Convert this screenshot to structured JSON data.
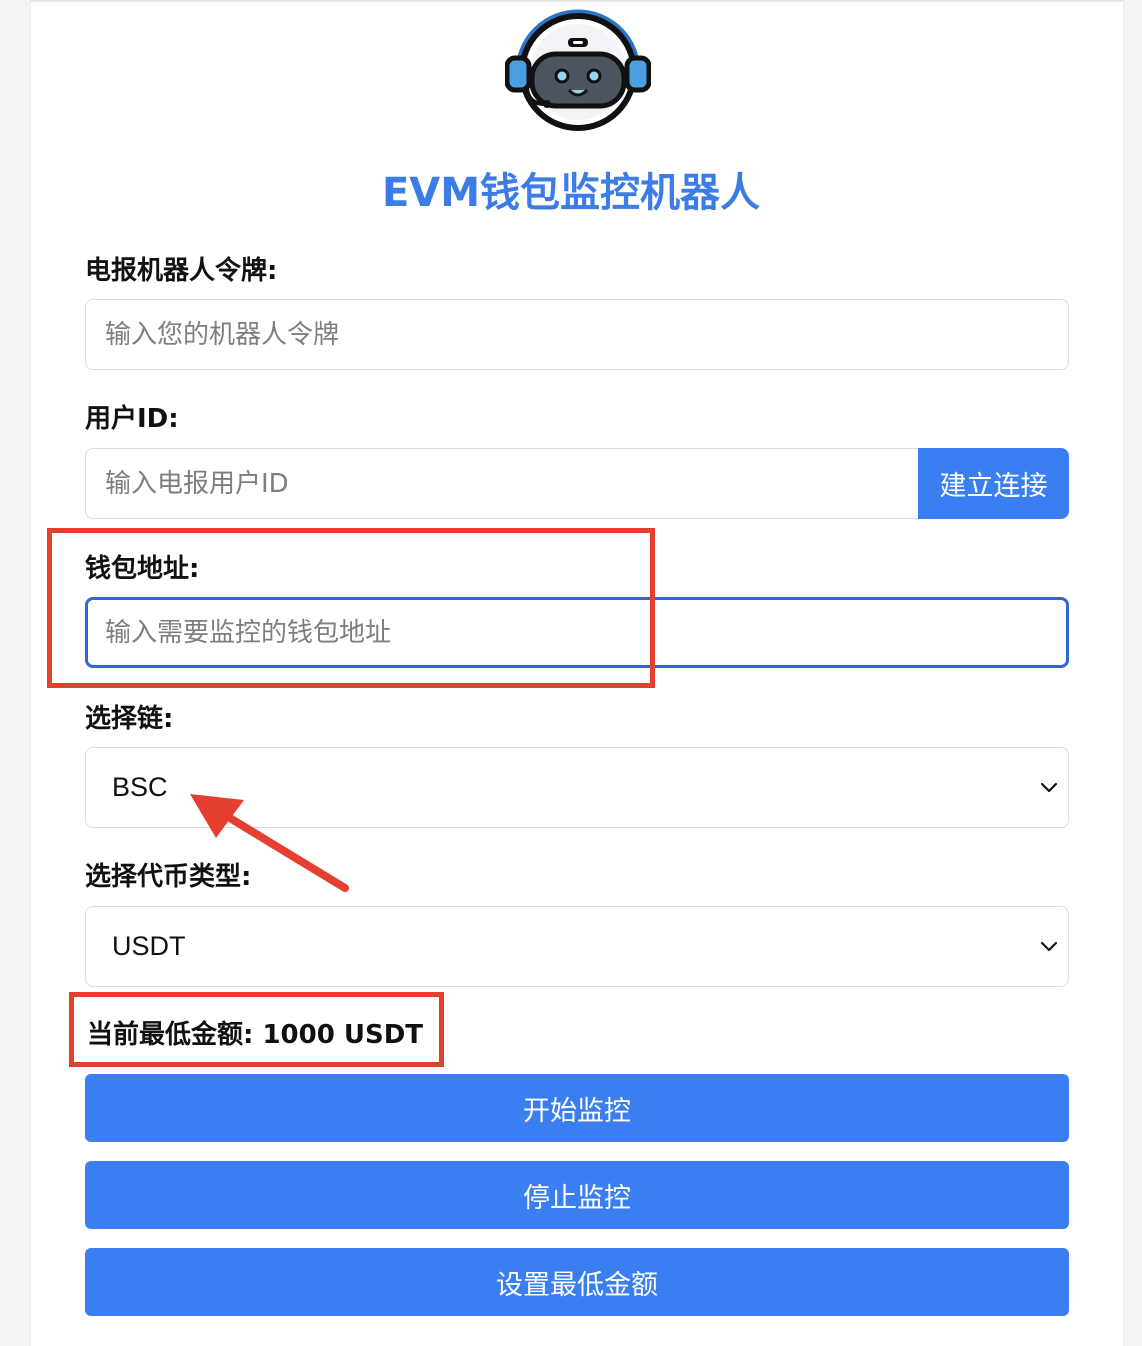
{
  "app": {
    "title": "EVM钱包监控机器人",
    "logo_icon": "robot-headset-logo"
  },
  "form": {
    "token_label": "电报机器人令牌:",
    "token_placeholder": "输入您的机器人令牌",
    "token_value": "",
    "user_id_label": "用户ID:",
    "user_id_placeholder": "输入电报用户ID",
    "user_id_value": "",
    "connect_button": "建立连接",
    "wallet_label": "钱包地址:",
    "wallet_placeholder": "输入需要监控的钱包地址",
    "wallet_value": "",
    "chain_label": "选择链:",
    "chain_selected": "BSC",
    "token_type_label": "选择代币类型:",
    "token_type_selected": "USDT",
    "min_amount_text": "当前最低金额: 1000 USDT"
  },
  "actions": {
    "start": "开始监控",
    "stop": "停止监控",
    "set_min": "设置最低金额"
  },
  "colors": {
    "accent": "#3a7ef2",
    "title": "#3b7ce6",
    "annotation": "#e5402f",
    "focus_border": "#2f66d9"
  }
}
